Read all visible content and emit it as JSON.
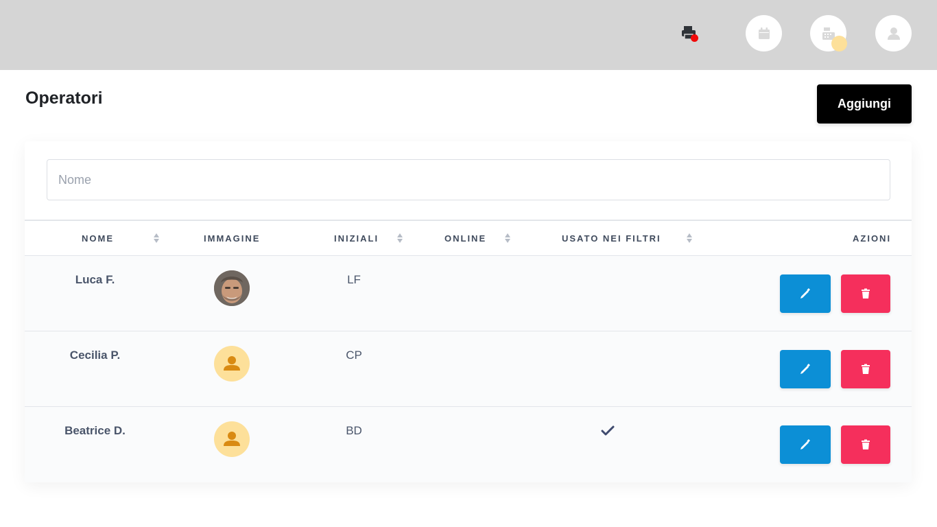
{
  "header": {
    "icons": [
      "printer-icon",
      "calendar-icon",
      "cash-register-icon",
      "user-icon"
    ]
  },
  "page": {
    "title": "Operatori",
    "add_label": "Aggiungi"
  },
  "search": {
    "placeholder": "Nome",
    "value": ""
  },
  "table": {
    "columns": [
      {
        "label": "Nome",
        "sortable": true
      },
      {
        "label": "Immagine",
        "sortable": false
      },
      {
        "label": "Iniziali",
        "sortable": true
      },
      {
        "label": "Online",
        "sortable": true
      },
      {
        "label": "Usato nei filtri",
        "sortable": true
      },
      {
        "label": "Azioni",
        "sortable": false
      }
    ],
    "rows": [
      {
        "name": "Luca F.",
        "image": "photo",
        "initials": "LF",
        "online": false,
        "used_in_filters": false
      },
      {
        "name": "Cecilia P.",
        "image": "placeholder-user-icon",
        "initials": "CP",
        "online": false,
        "used_in_filters": false
      },
      {
        "name": "Beatrice D.",
        "image": "placeholder-user-icon",
        "initials": "BD",
        "online": false,
        "used_in_filters": true
      }
    ]
  },
  "colors": {
    "topbar": "#d5d5d5",
    "edit": "#0c8fd6",
    "delete": "#f52f5c",
    "avatar_bg": "#fde09a",
    "avatar_icon": "#d98a12",
    "printer_alert": "#f00a0a"
  }
}
